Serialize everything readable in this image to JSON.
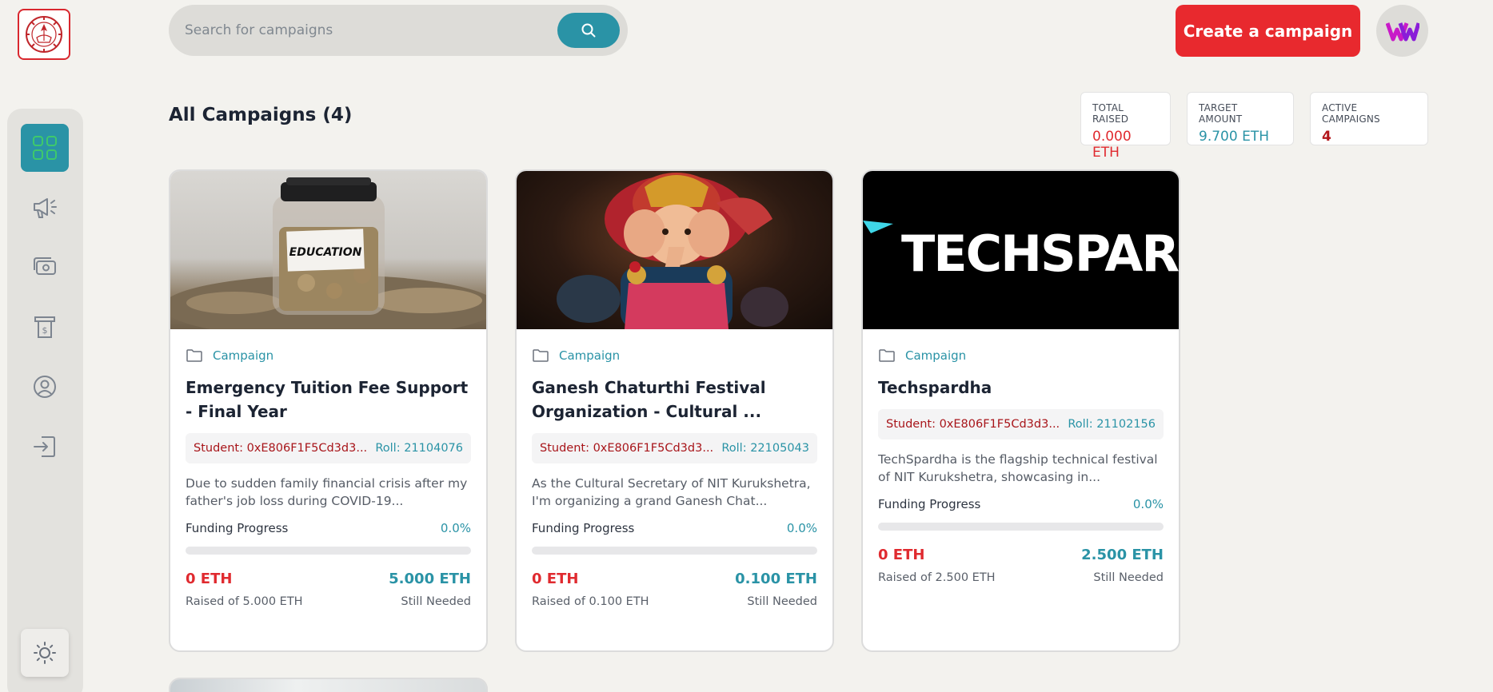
{
  "app": {
    "logo_label": "IIT Bhubaneswar logo"
  },
  "search": {
    "placeholder": "Search for campaigns"
  },
  "header": {
    "create_label": "Create a campaign"
  },
  "section": {
    "title": "All Campaigns (4)"
  },
  "stats": [
    {
      "label": "TOTAL RAISED",
      "value": "0.000 ETH",
      "color": "#e02a2f"
    },
    {
      "label": "TARGET AMOUNT",
      "value": "9.700 ETH",
      "color": "#2a93a6"
    },
    {
      "label": "ACTIVE CAMPAIGNS",
      "value": "4",
      "color": "#b3161b"
    }
  ],
  "sidebar": {
    "items": [
      {
        "icon": "dashboard-grid-icon",
        "active": true
      },
      {
        "icon": "megaphone-icon"
      },
      {
        "icon": "money-icon"
      },
      {
        "icon": "withdraw-icon"
      },
      {
        "icon": "profile-icon"
      },
      {
        "icon": "logout-icon"
      }
    ],
    "theme_icon": "sun-icon"
  },
  "campaigns": [
    {
      "image": "education-jar-image",
      "image_text": "EDUCATION",
      "category": "Campaign",
      "title": "Emergency Tuition Fee Support - Final Year",
      "student": "Student: 0xE806F1F5Cd3d3...",
      "roll": "Roll: 21104076",
      "description": "Due to sudden family financial crisis after my father's job loss during COVID-19...",
      "progress_label": "Funding Progress",
      "progress_pct": "0.0%",
      "progress": 0,
      "raised": "0 ETH",
      "needed": "5.000 ETH",
      "raised_sub": "Raised of 5.000 ETH",
      "needed_sub": "Still Needed"
    },
    {
      "image": "ganesh-idol-image",
      "category": "Campaign",
      "title": "Ganesh Chaturthi Festival Organization - Cultural ...",
      "student": "Student: 0xE806F1F5Cd3d3...",
      "roll": "Roll: 22105043",
      "description": "As the Cultural Secretary of NIT Kurukshetra, I'm organizing a grand Ganesh Chat...",
      "progress_label": "Funding Progress",
      "progress_pct": "0.0%",
      "progress": 0,
      "raised": "0 ETH",
      "needed": "0.100 ETH",
      "raised_sub": "Raised of 0.100 ETH",
      "needed_sub": "Still Needed"
    },
    {
      "image": "techspardha-logo-image",
      "image_text": "TECHSPARD",
      "category": "Campaign",
      "title": "Techspardha",
      "student": "Student: 0xE806F1F5Cd3d3...",
      "roll": "Roll: 21102156",
      "description": "TechSpardha is the flagship technical festival of NIT Kurukshetra, showcasing in...",
      "progress_label": "Funding Progress",
      "progress_pct": "0.0%",
      "progress": 0,
      "raised": "0 ETH",
      "needed": "2.500 ETH",
      "raised_sub": "Raised of 2.500 ETH",
      "needed_sub": "Still Needed"
    }
  ],
  "colors": {
    "accent": "#2a93a6",
    "brand_red": "#e8292e",
    "background": "#f3f2ee"
  }
}
